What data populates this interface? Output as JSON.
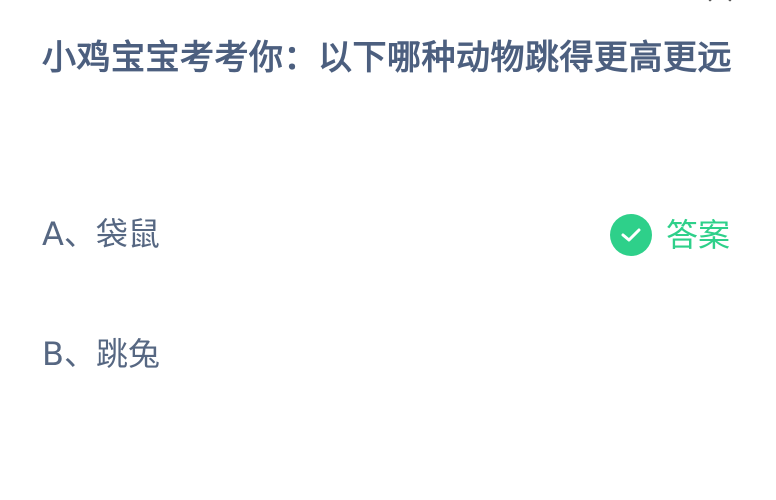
{
  "question": {
    "text": "小鸡宝宝考考你：以下哪种动物跳得更高更远"
  },
  "options": [
    {
      "label": "A、袋鼠",
      "is_answer": true
    },
    {
      "label": "B、跳兔",
      "is_answer": false
    }
  ],
  "answer_badge": {
    "label": "答案",
    "icon": "check-icon",
    "color": "#2ed08a"
  },
  "close_button": {
    "icon": "close-icon"
  },
  "colors": {
    "title": "#4c5f7f",
    "option_text": "#566782",
    "accent": "#2ed08a",
    "background": "#ffffff"
  }
}
